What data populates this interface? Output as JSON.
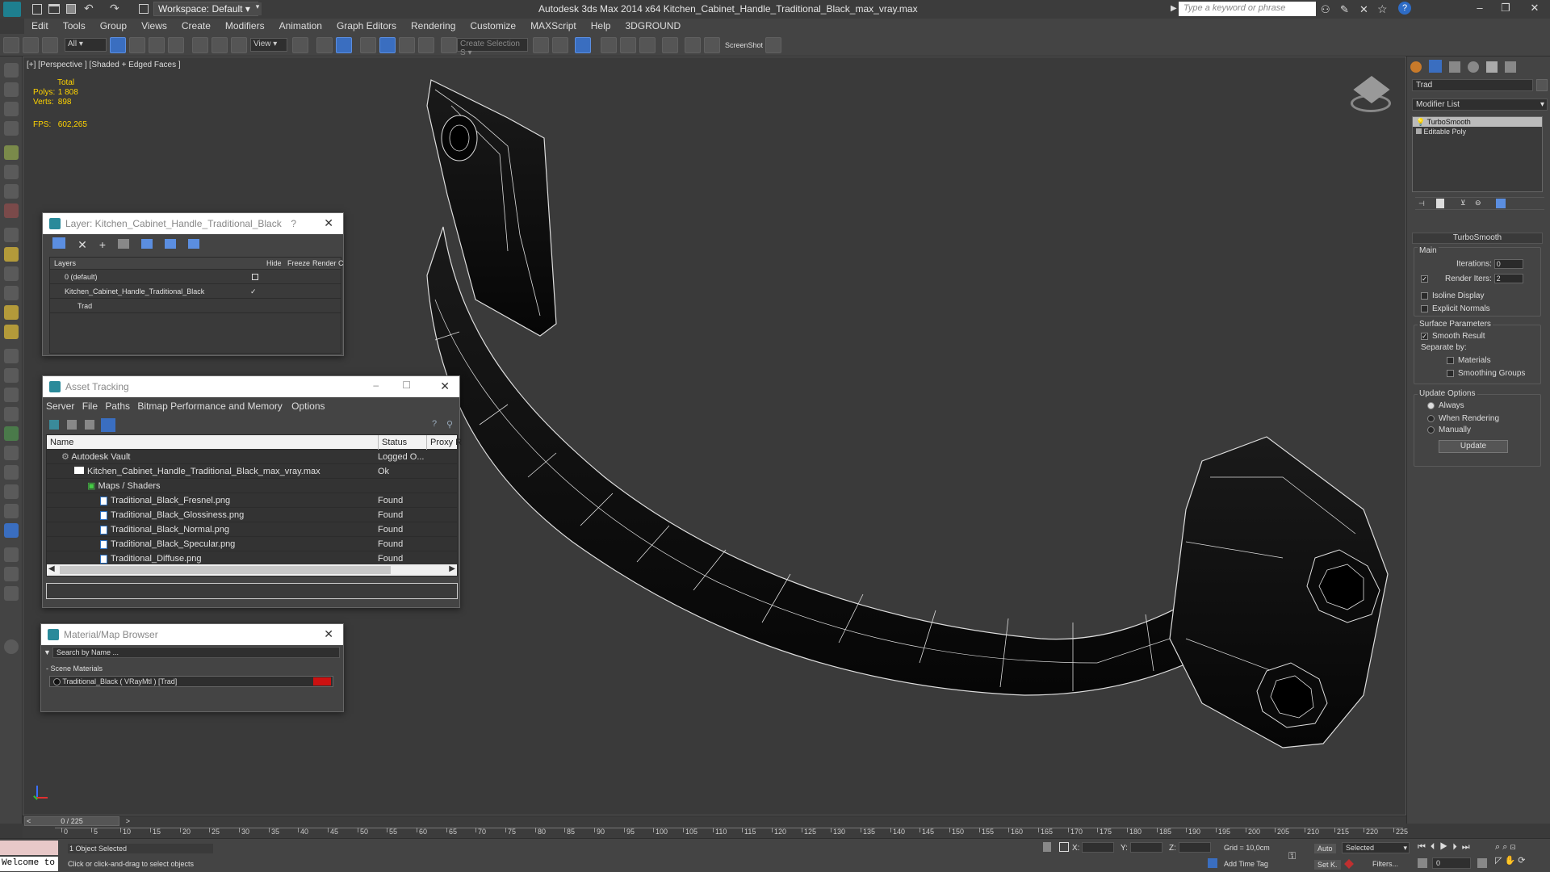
{
  "titlebar": {
    "workspace": "Workspace: Default",
    "app_title": "Autodesk 3ds Max  2014 x64    Kitchen_Cabinet_Handle_Traditional_Black_max_vray.max",
    "search_placeholder": "Type a keyword or phrase"
  },
  "menu": [
    "Edit",
    "Tools",
    "Group",
    "Views",
    "Create",
    "Modifiers",
    "Animation",
    "Graph Editors",
    "Rendering",
    "Customize",
    "MAXScript",
    "Help",
    "3DGROUND"
  ],
  "toolbar": {
    "filter_value": "All",
    "refcoord_value": "View",
    "selection_set_placeholder": "Create Selection S",
    "screenshot_label": "ScreenShot"
  },
  "viewport": {
    "label": "[+] [Perspective ] [Shaded + Edged Faces ]",
    "stats": {
      "total_label": "Total",
      "polys_label": "Polys:",
      "polys_value": "1 808",
      "verts_label": "Verts:",
      "verts_value": "898",
      "fps_label": "FPS:",
      "fps_value": "602,265"
    }
  },
  "layer_dialog": {
    "title": "Layer: Kitchen_Cabinet_Handle_Traditional_Black",
    "help": "?",
    "headers": [
      "Layers",
      "Hide",
      "Freeze",
      "Render",
      "C"
    ],
    "rows": [
      {
        "name": "0 (default)",
        "indent": 0
      },
      {
        "name": "Kitchen_Cabinet_Handle_Traditional_Black",
        "indent": 0
      },
      {
        "name": "Trad",
        "indent": 1
      }
    ]
  },
  "asset_dialog": {
    "title": "Asset Tracking",
    "menu": [
      "Server",
      "File",
      "Paths",
      "Bitmap Performance and Memory",
      "Options"
    ],
    "headers": [
      "Name",
      "Status",
      "Proxy R"
    ],
    "rows": [
      {
        "name": "Autodesk Vault",
        "status": "Logged O...",
        "indent": 1
      },
      {
        "name": "Kitchen_Cabinet_Handle_Traditional_Black_max_vray.max",
        "status": "Ok",
        "indent": 2
      },
      {
        "name": "Maps / Shaders",
        "status": "",
        "indent": 3
      },
      {
        "name": "Traditional_Black_Fresnel.png",
        "status": "Found",
        "indent": 4
      },
      {
        "name": "Traditional_Black_Glossiness.png",
        "status": "Found",
        "indent": 4
      },
      {
        "name": "Traditional_Black_Normal.png",
        "status": "Found",
        "indent": 4
      },
      {
        "name": "Traditional_Black_Specular.png",
        "status": "Found",
        "indent": 4
      },
      {
        "name": "Traditional_Diffuse.png",
        "status": "Found",
        "indent": 4
      }
    ]
  },
  "material_dialog": {
    "title": "Material/Map Browser",
    "search_placeholder": "Search by Name ...",
    "section": "- Scene Materials",
    "material": "Traditional_Black  ( VRayMtl )  [Trad]"
  },
  "command_panel": {
    "object_name": "Trad",
    "modifier_list": "Modifier List",
    "stack": [
      "TurboSmooth",
      "Editable Poly"
    ],
    "rollout_title": "TurboSmooth",
    "main_group": "Main",
    "iterations_label": "Iterations:",
    "iterations_value": "0",
    "render_iters_label": "Render Iters:",
    "render_iters_value": "2",
    "isoline_label": "Isoline Display",
    "explicit_normals_label": "Explicit Normals",
    "surface_group": "Surface Parameters",
    "smooth_result_label": "Smooth Result",
    "separate_by_label": "Separate by:",
    "materials_label": "Materials",
    "smoothing_groups_label": "Smoothing Groups",
    "update_group": "Update Options",
    "always_label": "Always",
    "when_rendering_label": "When Rendering",
    "manually_label": "Manually",
    "update_button": "Update"
  },
  "timeline": {
    "frame_counter": "0 / 225",
    "ticks": [
      "0",
      "5",
      "10",
      "15",
      "20",
      "25",
      "30",
      "35",
      "40",
      "45",
      "50",
      "55",
      "60",
      "65",
      "70",
      "75",
      "80",
      "85",
      "90",
      "95",
      "100",
      "105",
      "110",
      "115",
      "120",
      "125",
      "130",
      "135",
      "140",
      "145",
      "150",
      "155",
      "160",
      "165",
      "170",
      "175",
      "180",
      "185",
      "190",
      "195",
      "200",
      "205",
      "210",
      "215",
      "220",
      "225"
    ]
  },
  "statusbar": {
    "welcome": "Welcome to",
    "selected_text": "1 Object Selected",
    "prompt_text": "Click or click-and-drag to select objects",
    "x_label": "X:",
    "y_label": "Y:",
    "z_label": "Z:",
    "grid_text": "Grid = 10,0cm",
    "add_time_tag": "Add Time Tag",
    "auto_label": "Auto",
    "set_key_label": "Set K.",
    "selected_dropdown": "Selected",
    "filters_label": "Filters...",
    "frame_value": "0"
  },
  "colors": {
    "accent_blue": "#3a6ec0",
    "stats_yellow": "#ffd400",
    "material_red": "#cc1111"
  }
}
